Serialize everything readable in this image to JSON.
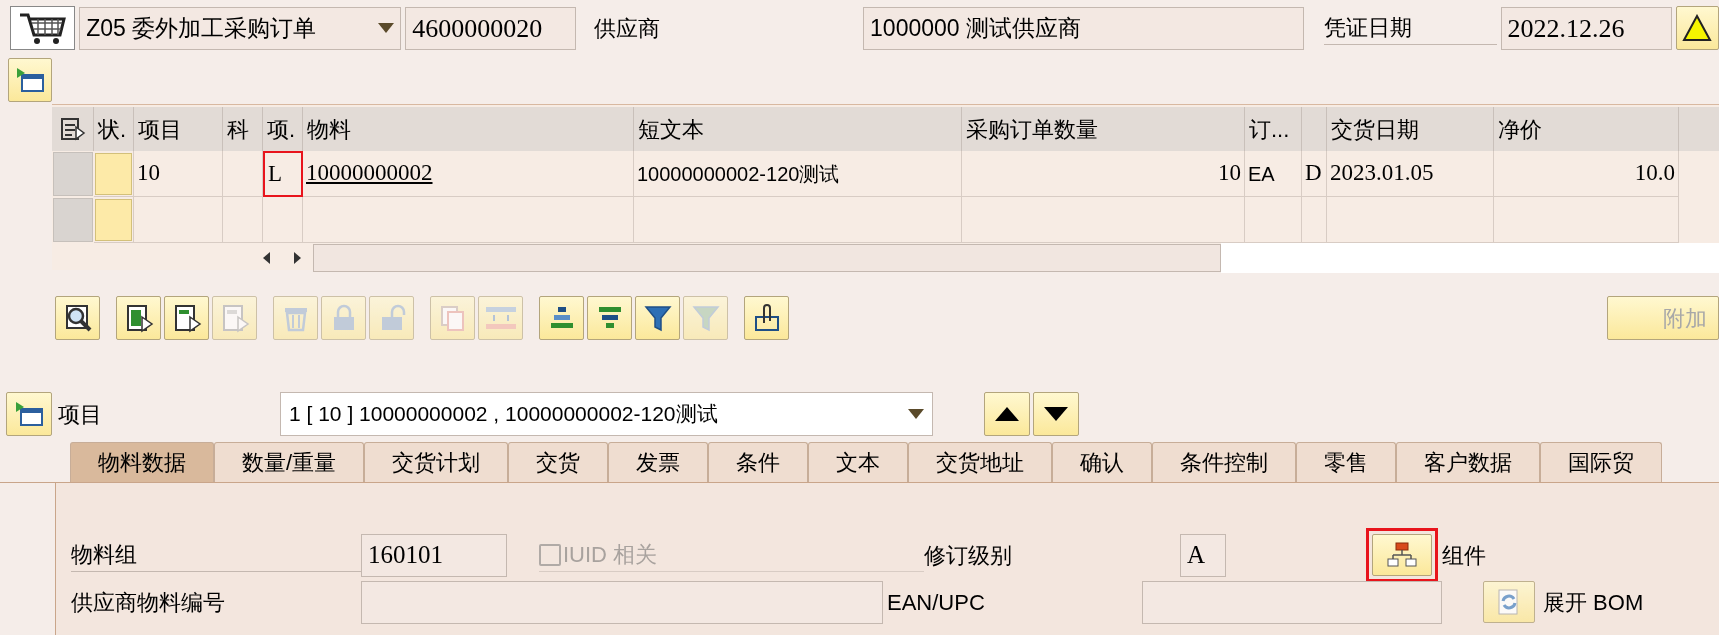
{
  "header": {
    "order_type": "Z05 委外加工采购订单",
    "order_number": "4600000020",
    "vendor_label": "供应商",
    "vendor": "1000000 测试供应商",
    "doc_date_label": "凭证日期",
    "doc_date": "2022.12.26"
  },
  "table": {
    "columns": [
      "状.",
      "项目",
      "科",
      "项.",
      "物料",
      "短文本",
      "采购订单数量",
      "订...",
      null,
      "交货日期",
      "净价"
    ],
    "rows": [
      {
        "cells": [
          null,
          {
            "text": "10"
          },
          null,
          {
            "text": "L",
            "marked": true
          },
          {
            "text": "10000000002",
            "kind": "link"
          },
          {
            "text": "10000000002-120测试"
          },
          {
            "text": "10"
          },
          {
            "text": "EA"
          },
          {
            "text": "D"
          },
          {
            "text": "2023.01.05"
          },
          {
            "text": "10.0"
          }
        ]
      }
    ]
  },
  "toolbar": [
    [
      {
        "kind": "details",
        "disabled": false
      }
    ],
    [
      {
        "kind": "select_all",
        "disabled": false
      },
      {
        "kind": "select_block",
        "disabled": false
      },
      {
        "kind": "deselect",
        "disabled": true
      }
    ],
    [
      {
        "kind": "delete",
        "disabled": true
      },
      {
        "kind": "lock",
        "disabled": true
      },
      {
        "kind": "unlock",
        "disabled": true
      }
    ],
    [
      {
        "kind": "copy",
        "disabled": true
      },
      {
        "kind": "defaults",
        "disabled": true
      }
    ],
    [
      {
        "kind": "sort_ascending",
        "disabled": false
      },
      {
        "kind": "sort_descending",
        "disabled": false
      },
      {
        "kind": "filter",
        "disabled": false
      },
      {
        "kind": "filter_settings",
        "disabled": true
      }
    ],
    [
      {
        "kind": "attachment",
        "disabled": false
      }
    ]
  ],
  "extra_button": {
    "label": "附加",
    "disabled": true
  },
  "item_selector": {
    "label": "项目",
    "value": "1 [ 10 ] 10000000002 , 10000000002-120测试"
  },
  "tabs": [
    {
      "label": "物料数据",
      "selected": true
    },
    {
      "label": "数量/重量",
      "selected": false
    },
    {
      "label": "交货计划",
      "selected": false
    },
    {
      "label": "交货",
      "selected": false
    },
    {
      "label": "发票",
      "selected": false
    },
    {
      "label": "条件",
      "selected": false
    },
    {
      "label": "文本",
      "selected": false
    },
    {
      "label": "交货地址",
      "selected": false
    },
    {
      "label": "确认",
      "selected": false
    },
    {
      "label": "条件控制",
      "selected": false
    },
    {
      "label": "零售",
      "selected": false
    },
    {
      "label": "客户数据",
      "selected": false
    },
    {
      "label": "国际贸",
      "selected": false
    }
  ],
  "detail": {
    "material_group_label": "物料组",
    "material_group": "160101",
    "iuid": {
      "label": "IUID 相关",
      "checked": false,
      "disabled": true
    },
    "revision_label": "修订级别",
    "revision": "A",
    "components_button": {
      "label": "组件",
      "marked": true
    },
    "vendor_material_label": "供应商物料编号",
    "ean_label": "EAN/UPC",
    "expand_bom_button": {
      "label": "展开 BOM"
    }
  }
}
